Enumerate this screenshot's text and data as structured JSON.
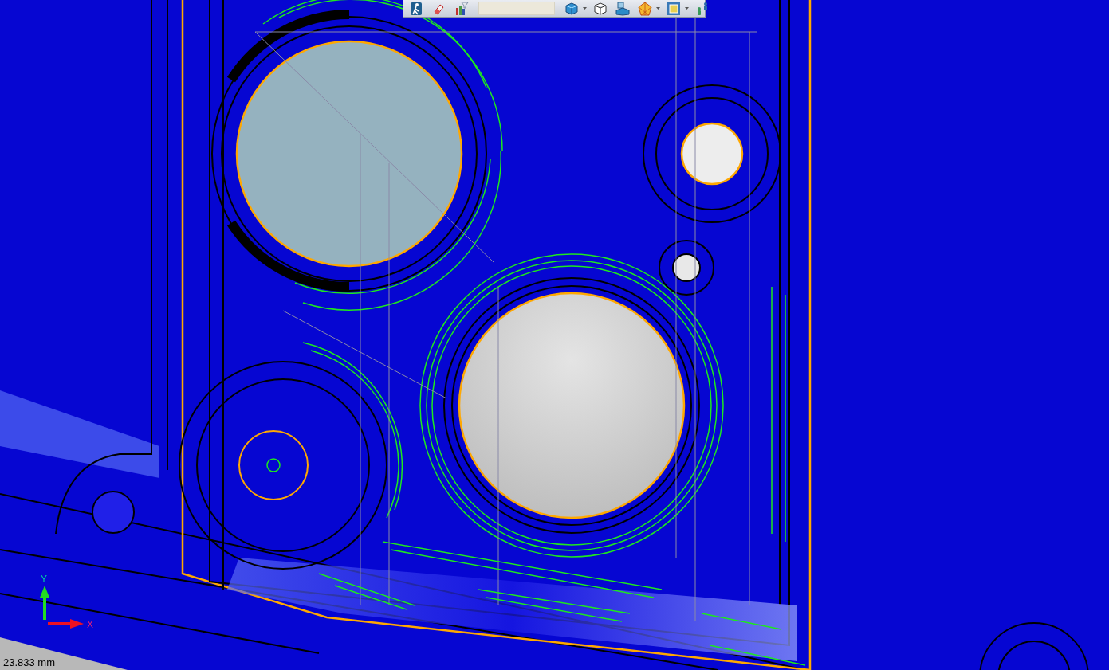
{
  "toolbar": {
    "items": [
      {
        "kind": "walk",
        "dropdown": false
      },
      {
        "kind": "eraser",
        "dropdown": false
      },
      {
        "kind": "filter",
        "dropdown": false
      },
      {
        "kind": "field",
        "dropdown": false
      },
      {
        "kind": "shaded-cube",
        "dropdown": true
      },
      {
        "kind": "wire-cube",
        "dropdown": false
      },
      {
        "kind": "view",
        "dropdown": false
      },
      {
        "kind": "render",
        "dropdown": true
      },
      {
        "kind": "frame",
        "dropdown": true
      },
      {
        "kind": "figures",
        "dropdown": false
      }
    ]
  },
  "axes": {
    "y_label": "Y",
    "x_label": "X"
  },
  "scale": "23.833 mm"
}
